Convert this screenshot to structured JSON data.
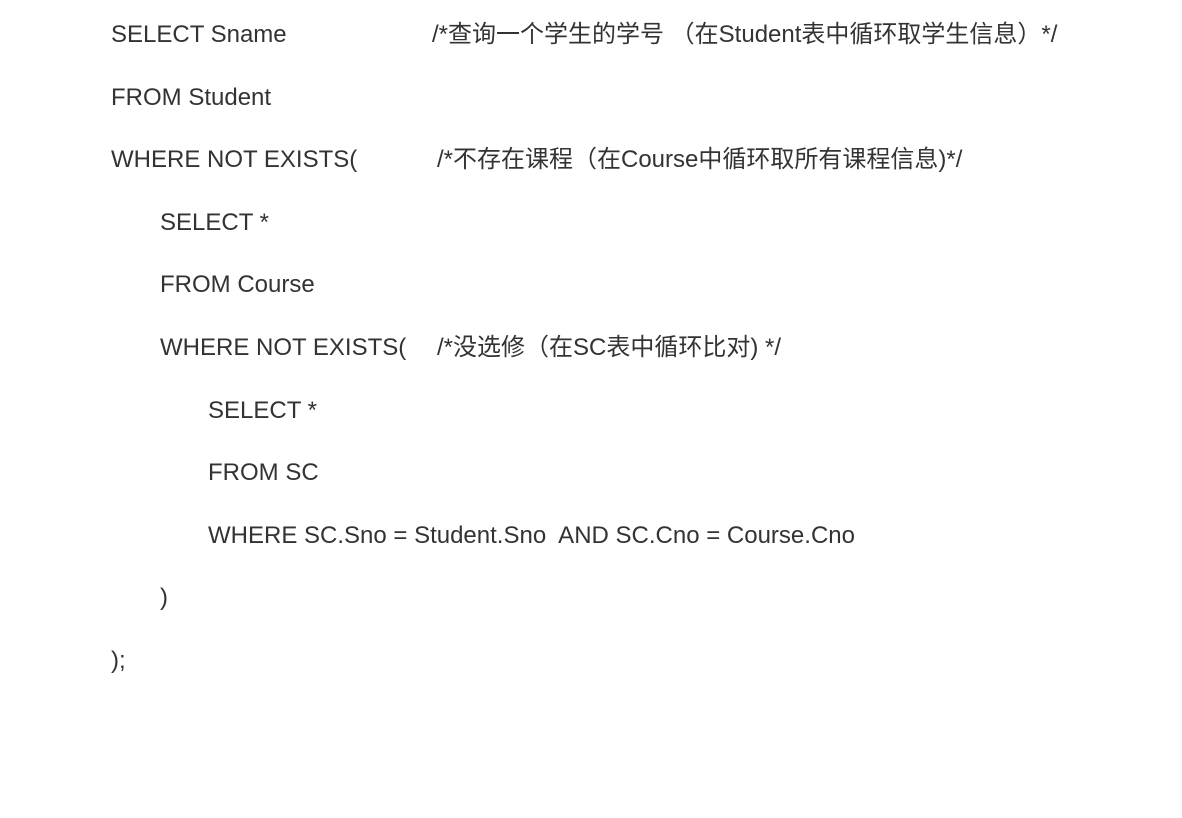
{
  "code_lines": [
    {
      "code": "SELECT Sname",
      "comment": "/*查询一个学生的学号 （在Student表中循环取学生信息）*/"
    },
    {
      "code": "FROM Student"
    },
    {
      "code": "WHERE NOT EXISTS(",
      "comment": "/*不存在课程（在Course中循环取所有课程信息)*/"
    },
    {
      "code": "SELECT *"
    },
    {
      "code": "FROM Course"
    },
    {
      "code": "WHERE NOT EXISTS(",
      "comment": "/*没选修（在SC表中循环比对) */"
    },
    {
      "code": "SELECT *"
    },
    {
      "code": "FROM SC"
    },
    {
      "code": "WHERE SC.Sno = Student.Sno  AND SC.Cno = Course.Cno"
    },
    {
      "code": ")"
    },
    {
      "code": ");"
    }
  ]
}
